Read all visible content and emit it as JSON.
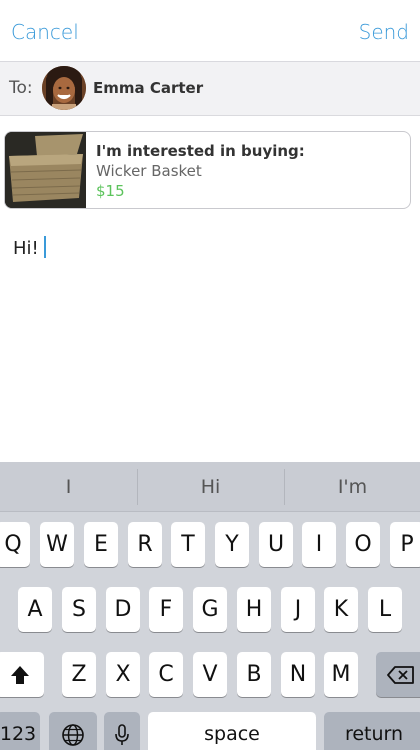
{
  "nav": {
    "cancel_label": "Cancel",
    "send_label": "Send"
  },
  "recipient": {
    "to_label": "To:",
    "name": "Emma Carter"
  },
  "listing": {
    "title": "I'm interested in buying:",
    "item": "Wicker Basket",
    "price": "$15"
  },
  "message": {
    "text": "Hi!"
  },
  "keyboard": {
    "suggestions": [
      "I",
      "Hi",
      "I'm"
    ],
    "row1": [
      "Q",
      "W",
      "E",
      "R",
      "T",
      "Y",
      "U",
      "I",
      "O",
      "P"
    ],
    "row2": [
      "A",
      "S",
      "D",
      "F",
      "G",
      "H",
      "J",
      "K",
      "L"
    ],
    "row3": [
      "Z",
      "X",
      "C",
      "V",
      "B",
      "N",
      "M"
    ],
    "numbers_label": "123",
    "space_label": "space",
    "return_label": "return",
    "icons": {
      "shift": "shift-arrow-icon",
      "delete": "backspace-icon",
      "globe": "globe-icon",
      "mic": "microphone-icon"
    }
  },
  "colors": {
    "accent": "#3a9ad9",
    "price": "#5cc35c",
    "keyboard_bg": "#d1d4da"
  }
}
